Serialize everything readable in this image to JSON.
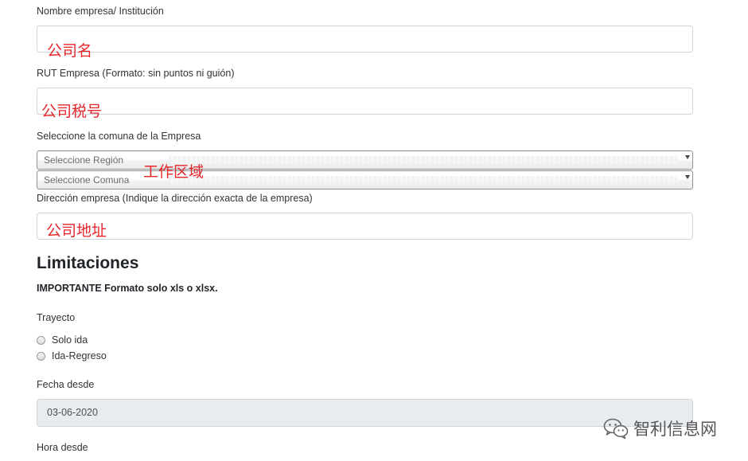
{
  "form": {
    "company_name": {
      "label": "Nombre empresa/ Institución",
      "value": "",
      "annotation": "公司名"
    },
    "rut": {
      "label": "RUT Empresa (Formato: sin puntos ni guión)",
      "value": "",
      "annotation": "公司税号"
    },
    "commune": {
      "label": "Seleccione la comuna de la Empresa",
      "region_select": "Seleccione Región",
      "commune_select": "Seleccione Comuna",
      "annotation": "工作区域"
    },
    "address": {
      "label": "Dirección empresa (Indique la dirección exacta de la empresa)",
      "value": "",
      "annotation": "公司地址"
    }
  },
  "limitations": {
    "title": "Limitaciones",
    "important": "IMPORTANTE Formato solo xls o xlsx.",
    "trayecto": {
      "label": "Trayecto",
      "options": [
        "Solo ida",
        "Ida-Regreso"
      ]
    },
    "fecha_desde": {
      "label": "Fecha desde",
      "value": "03-06-2020"
    },
    "hora_desde": {
      "label": "Hora desde"
    }
  },
  "watermark": {
    "text": "智利信息网",
    "icon": "wechat-icon"
  },
  "colors": {
    "annotation": "#e5262b",
    "border": "#ced4da",
    "disabled_bg": "#e9ecef"
  }
}
